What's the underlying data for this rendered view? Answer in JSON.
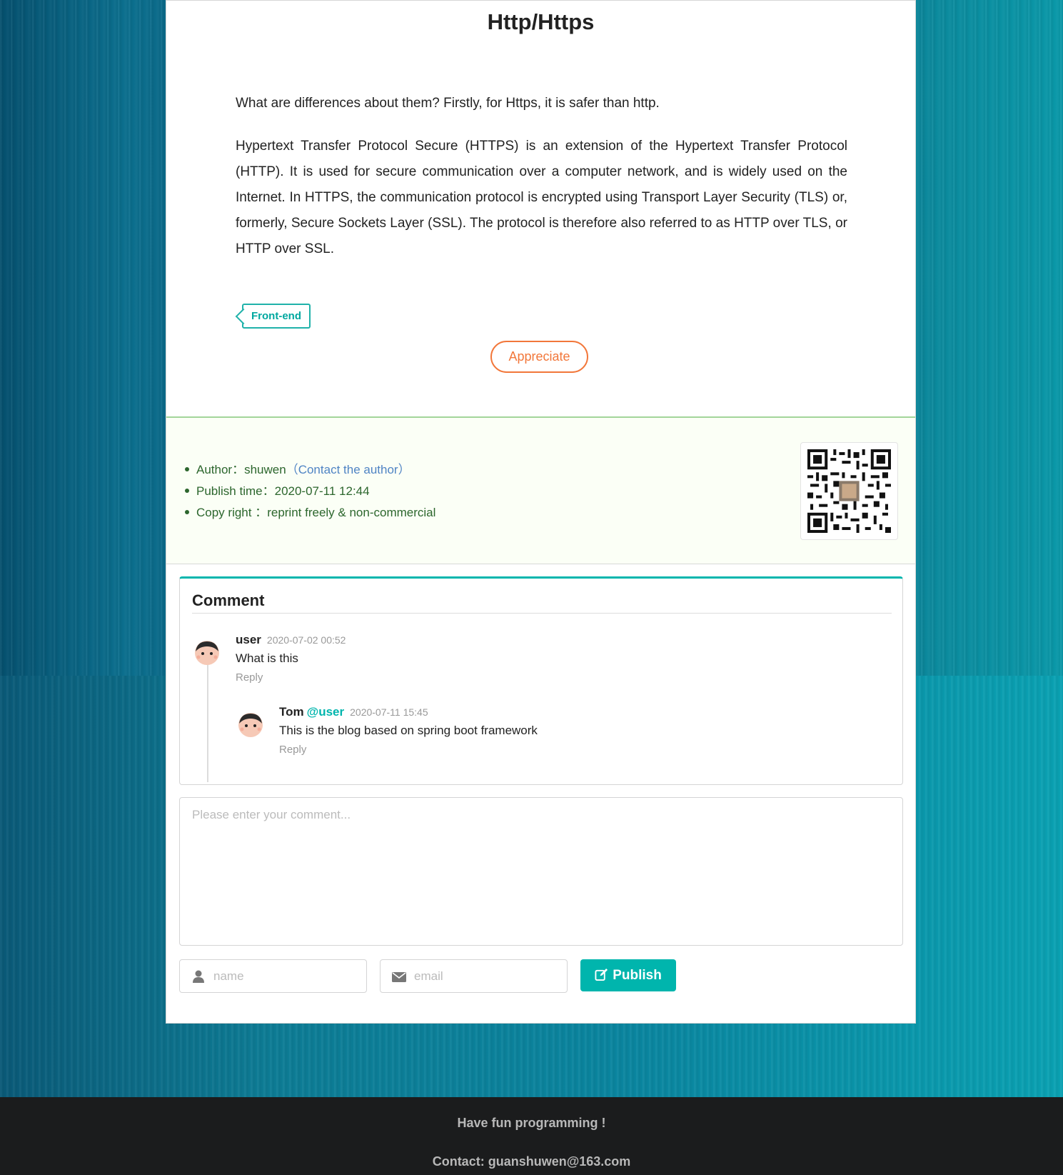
{
  "post": {
    "title": "Http/Https",
    "paragraphs": [
      "What are differences about them? Firstly, for Https, it is safer than http.",
      "Hypertext Transfer Protocol Secure (HTTPS) is an extension of the Hypertext Transfer Protocol (HTTP). It is used for secure communication over a computer network, and is widely used on the Internet. In HTTPS, the communication protocol is encrypted using Transport Layer Security (TLS) or, formerly, Secure Sockets Layer (SSL). The protocol is therefore also referred to as HTTP over TLS, or HTTP over SSL."
    ],
    "tag": "Front-end",
    "appreciate_label": "Appreciate"
  },
  "info": {
    "author_label": "Author：",
    "author": "shuwen",
    "contact_link": "（Contact the author）",
    "publish_label": "Publish time：",
    "publish_time": "2020-07-11 12:44",
    "copyright_label": "Copy right ：",
    "copyright": "reprint freely & non-commercial"
  },
  "comments": {
    "heading": "Comment",
    "items": [
      {
        "author": "user",
        "date": "2020-07-02 00:52",
        "text": "What is this",
        "reply_label": "Reply"
      },
      {
        "author": "Tom",
        "at": "@user",
        "date": "2020-07-11 15:45",
        "text": "This is the blog based on spring boot framework",
        "reply_label": "Reply"
      }
    ]
  },
  "form": {
    "comment_placeholder": "Please enter your comment...",
    "name_placeholder": "name",
    "email_placeholder": "email",
    "publish_label": "Publish"
  },
  "footer": {
    "line1": "Have fun programming !",
    "line2": "Contact: guanshuwen@163.com"
  },
  "colors": {
    "accent_teal": "#00b5ad",
    "appreciate_orange": "#f2773a",
    "info_green": "#2c662d",
    "link_blue": "#4f84c4"
  },
  "icons": [
    "user-icon",
    "envelope-icon",
    "edit-icon",
    "qr-code"
  ]
}
